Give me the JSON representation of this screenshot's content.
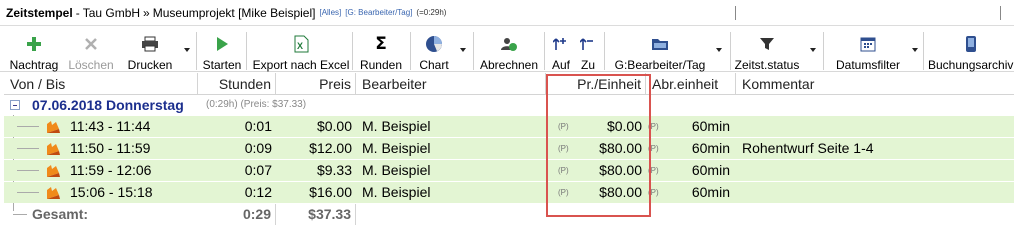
{
  "title": {
    "app": "Zeitstempel",
    "separator": "-",
    "company": "Tau GmbH",
    "arrow": "»",
    "project": "Museumprojekt [Mike Beispiel]",
    "tag_all": "[Alles]",
    "tag_group": "[G: Bearbeiter/Tag]",
    "tag_time": "(=0:29h)"
  },
  "toolbar": {
    "nachtrag": "Nachtrag",
    "loeschen": "Löschen",
    "drucken": "Drucken",
    "starten": "Starten",
    "export": "Export nach Excel",
    "runden": "Runden",
    "chart": "Chart",
    "abrechnen": "Abrechnen",
    "auf": "Auf",
    "zu": "Zu",
    "gruppierung": "G:Bearbeiter/Tag",
    "zeitstatus": "Zeitst.status",
    "datumsfilter": "Datumsfilter",
    "buchungsarchiv": "Buchungsarchiv"
  },
  "columns": {
    "von_bis": "Von / Bis",
    "stunden": "Stunden",
    "preis": "Preis",
    "bearbeiter": "Bearbeiter",
    "pr_einheit": "Pr./Einheit",
    "abr_einheit": "Abr.einheit",
    "kommentar": "Kommentar"
  },
  "group": {
    "date": "07.06.2018 Donnerstag",
    "meta": "(0:29h) (Preis: $37.33)"
  },
  "rows": [
    {
      "time": "11:43 - 11:44",
      "stunden": "0:01",
      "preis": "$0.00",
      "bearbeiter": "M. Beispiel",
      "p1": "(P)",
      "pr_einheit": "$0.00",
      "p2": "(P)",
      "abr_einheit": "60min",
      "kommentar": ""
    },
    {
      "time": "11:50 - 11:59",
      "stunden": "0:09",
      "preis": "$12.00",
      "bearbeiter": "M. Beispiel",
      "p1": "(P)",
      "pr_einheit": "$80.00",
      "p2": "(P)",
      "abr_einheit": "60min",
      "kommentar": "Rohentwurf Seite 1-4"
    },
    {
      "time": "11:59 - 12:06",
      "stunden": "0:07",
      "preis": "$9.33",
      "bearbeiter": "M. Beispiel",
      "p1": "(P)",
      "pr_einheit": "$80.00",
      "p2": "(P)",
      "abr_einheit": "60min",
      "kommentar": ""
    },
    {
      "time": "15:06 - 15:18",
      "stunden": "0:12",
      "preis": "$16.00",
      "bearbeiter": "M. Beispiel",
      "p1": "(P)",
      "pr_einheit": "$80.00",
      "p2": "(P)",
      "abr_einheit": "60min",
      "kommentar": ""
    }
  ],
  "total": {
    "label": "Gesamt:",
    "stunden": "0:29",
    "preis": "$37.33"
  },
  "colors": {
    "row_bg": "#e3f5d3",
    "group_text": "#1c2f8e",
    "highlight": "#d9534f",
    "icon_green": "#3aa34a"
  }
}
